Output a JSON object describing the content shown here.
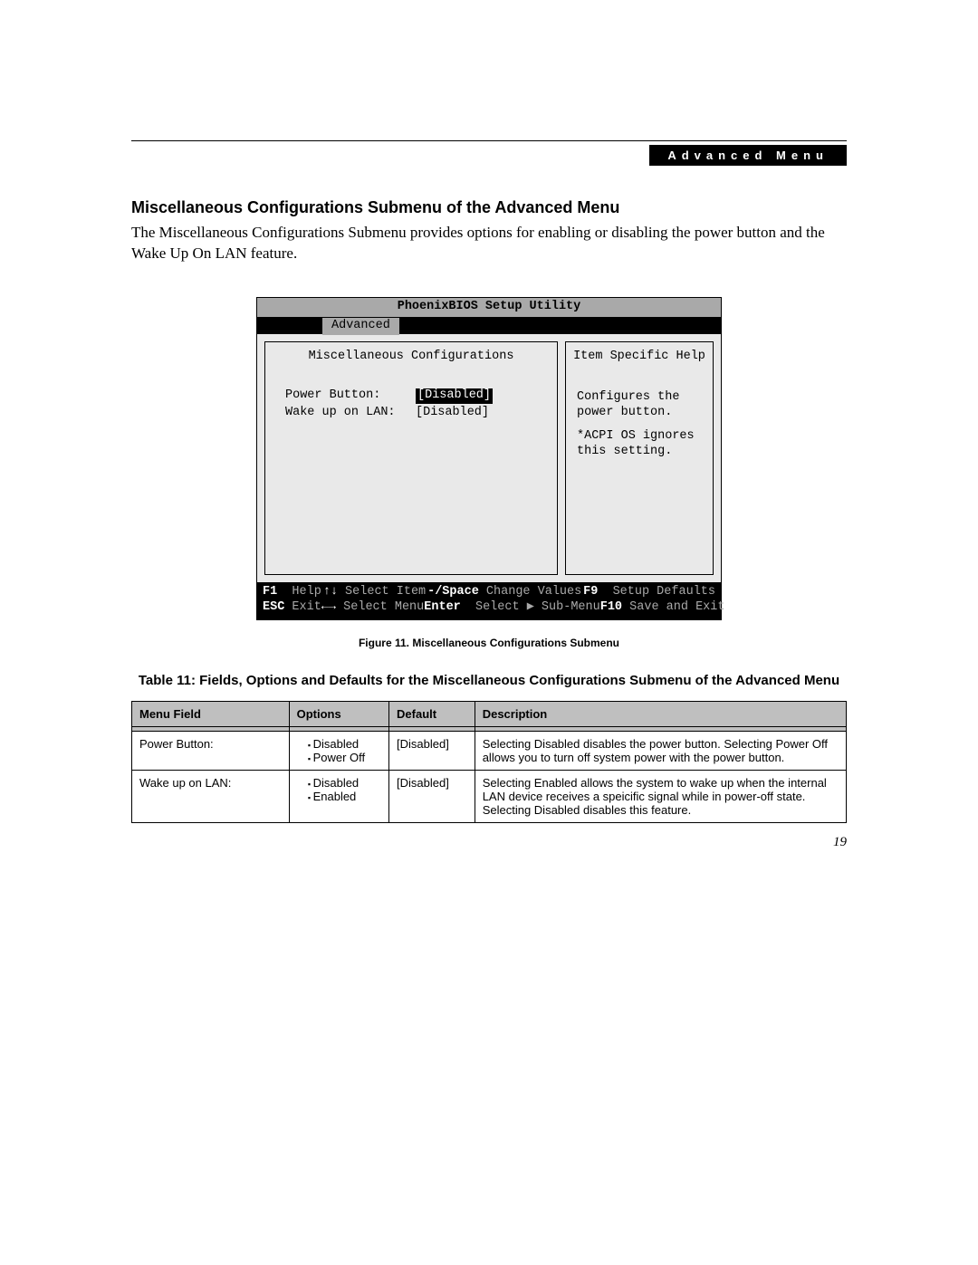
{
  "header": {
    "tag": "Advanced Menu"
  },
  "section": {
    "title": "Miscellaneous Configurations Submenu of the Advanced Menu",
    "intro": "The Miscellaneous Configurations Submenu provides options for enabling or disabling the power button and the Wake Up On LAN feature."
  },
  "bios": {
    "utility_title": "PhoenixBIOS Setup Utility",
    "active_tab": "Advanced",
    "left_pane_title": "Miscellaneous Configurations",
    "right_pane_title": "Item Specific Help",
    "fields": {
      "power_button_label": "Power Button:",
      "power_button_value": "[Disabled]",
      "wake_lan_label": "Wake up on LAN:",
      "wake_lan_value": "[Disabled]"
    },
    "help_text_line1": "Configures the power button.",
    "help_text_line2": "*ACPI OS ignores this setting.",
    "footer": {
      "f1": "F1",
      "help": "Help",
      "updown": "↑↓",
      "select_item": "Select Item",
      "minus_space": "-/Space",
      "change_values": "Change Values",
      "f9": "F9",
      "setup_defaults": "Setup Defaults",
      "esc": "ESC",
      "exit": "Exit",
      "leftright": "←→",
      "select_menu": "Select Menu",
      "enter": "Enter",
      "select_submenu": "Select ▶ Sub-Menu",
      "f10": "F10",
      "save_exit": "Save and Exit"
    }
  },
  "figure_caption": "Figure 11.  Miscellaneous Configurations Submenu",
  "table": {
    "title": "Table 11: Fields, Options and Defaults for the Miscellaneous Configurations Submenu of the Advanced Menu",
    "headers": {
      "menu_field": "Menu Field",
      "options": "Options",
      "default": "Default",
      "description": "Description"
    },
    "rows": [
      {
        "menu_field": "Power Button:",
        "options": [
          "Disabled",
          "Power Off"
        ],
        "default": "[Disabled]",
        "description": "Selecting Disabled disables the power button. Selecting Power Off allows you to turn off system power with the power button."
      },
      {
        "menu_field": "Wake up on LAN:",
        "options": [
          "Disabled",
          "Enabled"
        ],
        "default": "[Disabled]",
        "description": "Selecting Enabled allows the system to wake up when the internal LAN device receives a speicific signal while in power-off state. Selecting Disabled disables this feature."
      }
    ]
  },
  "page_number": "19"
}
